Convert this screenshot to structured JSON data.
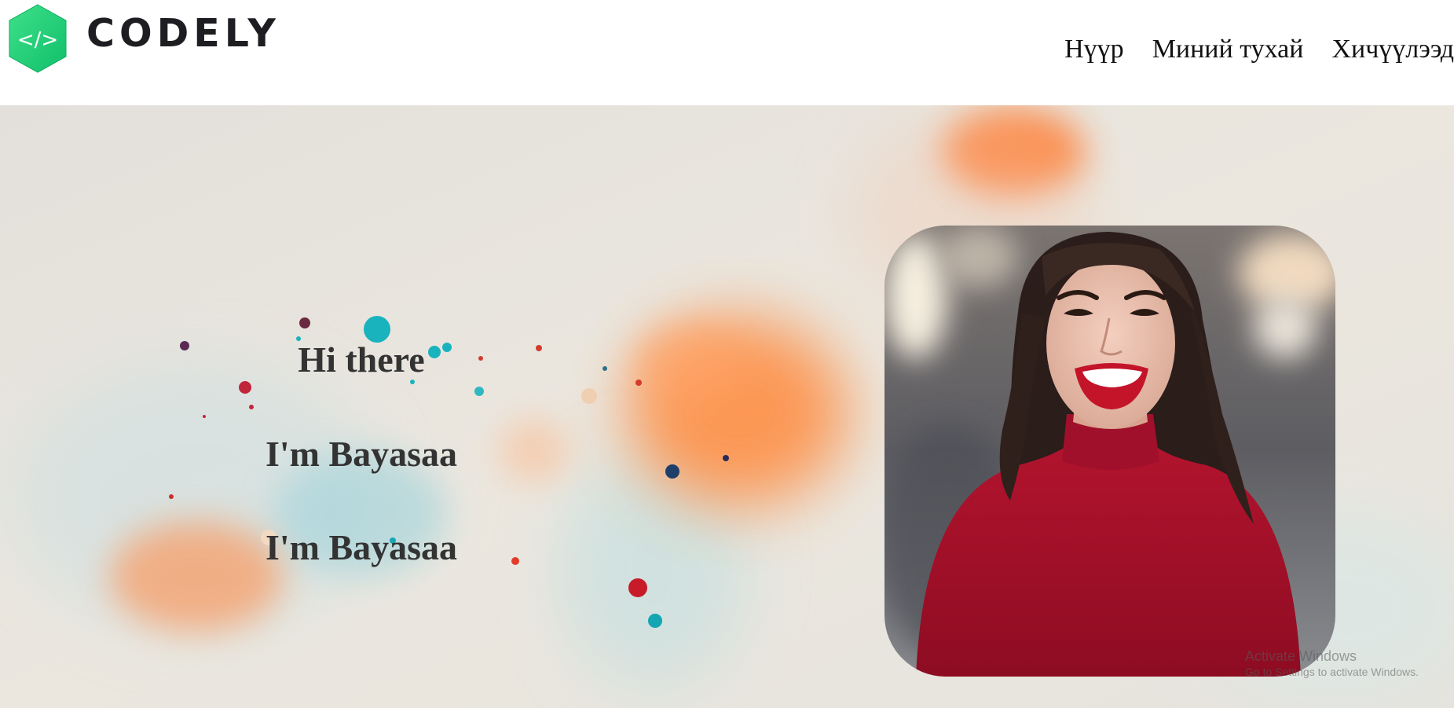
{
  "brand": {
    "name": "CODELY",
    "code_glyph": "</>",
    "colors": {
      "hex_start": "#3ee08a",
      "hex_end": "#12c46c",
      "text": "#1e1e22"
    }
  },
  "nav": {
    "items": [
      {
        "label": "Нүүр"
      },
      {
        "label": "Миний тухай"
      },
      {
        "label": "Хичүүлээд"
      }
    ]
  },
  "hero": {
    "greeting": "Hi there",
    "intro_1": "I'm Bayasaa",
    "intro_2": "I'm Bayasaa",
    "text_color": "#333333",
    "background": "watercolor-paint-splash",
    "photo": "smiling-woman-red-sweater"
  },
  "system_watermark": {
    "title": "Activate Windows",
    "subtitle": "Go to Settings to activate Windows."
  }
}
